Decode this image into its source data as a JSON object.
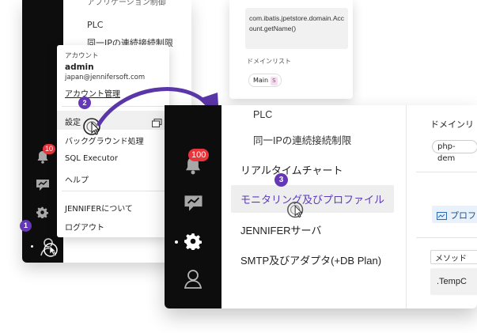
{
  "back_window": {
    "list_header": "アプリケーション制御",
    "list_items": [
      "PLC",
      "同一IPの連続接続制限"
    ],
    "menu": {
      "account_label": "アカウント",
      "user_name": "admin",
      "user_email": "japan@jennifersoft.com",
      "account_manage": "アカウント管理",
      "settings": "設定",
      "background": "バックグラウンド処理",
      "sql_executor": "SQL Executor",
      "help": "ヘルプ",
      "about": "JENNIFERについて",
      "logout": "ログアウト"
    },
    "notification_count": "10"
  },
  "top_panel": {
    "code_text": "com.ibatis.jpetstore.domain.Account.getName()",
    "domain_list_label": "ドメインリスト",
    "domain_tag": "Main",
    "domain_tag_badge": "S"
  },
  "front_window": {
    "notification_count": "100",
    "menu": {
      "plc": "PLC",
      "ip_limit": "同一IPの連続接続制限",
      "realtime_chart": "リアルタイムチャート",
      "monitoring": "モニタリング及びプロファイル",
      "jennifer_server": "JENNIFERサーバ",
      "smtp_adapter": "SMTP及びアダプタ(+DB Plan)"
    },
    "right_col": {
      "domain_list": "ドメインリ",
      "domain_pill": "php-dem",
      "profile": "プロフ",
      "method_label": "メソッド",
      "temp_value": ".TempC"
    }
  },
  "steps": {
    "one": "1",
    "two": "2",
    "three": "3"
  },
  "colors": {
    "accent": "#6438b6",
    "rail": "#0d0d0d",
    "badge": "#e8343b",
    "highlight_text": "#5b3bb8"
  }
}
